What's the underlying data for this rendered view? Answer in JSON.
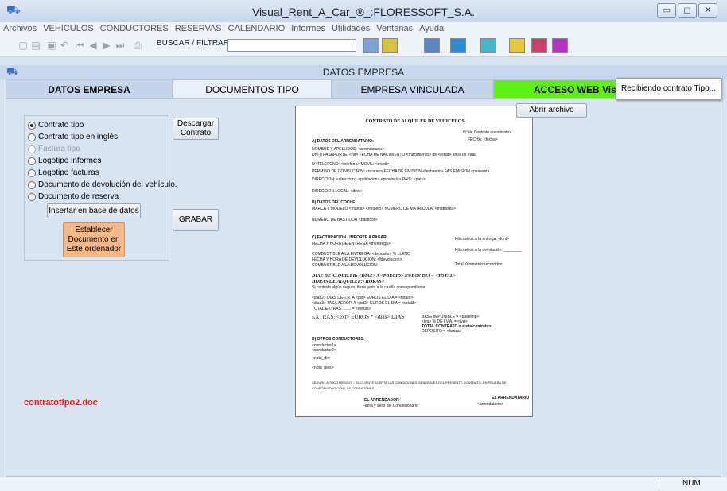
{
  "window": {
    "title": "Visual_Rent_A_Car_®_:FLORESSOFT_S.A."
  },
  "menu": [
    "Archivos",
    "VEHICULOS",
    "CONDUCTORES",
    "RESERVAS",
    "CALENDARIO",
    "Informes",
    "Utilidades",
    "Ventanas",
    "Ayuda"
  ],
  "toolbar": {
    "search_label": "BUSCAR / FILTRAR:",
    "search_value": ""
  },
  "mdi": {
    "title": "DATOS EMPRESA"
  },
  "tabs": [
    "DATOS EMPRESA",
    "DOCUMENTOS TIPO",
    "EMPRESA VINCULADA",
    "ACCESO WEB Vis"
  ],
  "options": {
    "items": [
      {
        "label": "Contrato tipo",
        "selected": true,
        "enabled": true
      },
      {
        "label": "Contrato tipo en inglés",
        "selected": false,
        "enabled": true
      },
      {
        "label": "Factura tipo",
        "selected": false,
        "enabled": false
      },
      {
        "label": "Logotipo informes",
        "selected": false,
        "enabled": true
      },
      {
        "label": "Logotipo facturas",
        "selected": false,
        "enabled": true
      },
      {
        "label": "Documento de devolución del vehículo.",
        "selected": false,
        "enabled": true
      },
      {
        "label": "Documento de reserva",
        "selected": false,
        "enabled": true
      }
    ],
    "insert_button": "Insertar en base de datos",
    "set_document_button": "Establecer Documento en Este ordenador"
  },
  "buttons": {
    "download": "Descargar Contrato",
    "save": "GRABAR",
    "open_file": "Abrir archivo"
  },
  "filename": "contratotipo2.doc",
  "tooltip": "Recibiendo contrato Tipo...",
  "status": {
    "num": "NUM"
  },
  "colors": {
    "accent_tab": "#5ef010",
    "filename": "#e02020",
    "set_doc_button": "#f4b98a"
  },
  "contract": {
    "title": "CONTRATO DE ALQUILER DE VEHICULOS",
    "contract_no": "Nº de Contrato  <ncontrato>",
    "fecha": "FECHA:  <fecha>",
    "section_a": "A) DATOS DEL ARRENDATARIO:",
    "a_lines": [
      "NOMBRE Y APELLIDOS:  <arrendatario>",
      "DNI o PASAPORTE:  <nif>    FECHA DE NACIMIENTO  <fnacimiento>  de <edad>  años de edad",
      "Nº TELEFONO:  <telefono>                    MOVIL:  <movil>",
      "PERMISO DE CONDUCIR Nº  <ncarne>    FECHA DE EMISION  <fechaemi>  FAS EMISION  <paisemi>",
      "DIRECCION:   <direccion>  <poblacion>  <provincia>        PAIS:  <pais>",
      "DIRECCION LOCAL:  <direl>"
    ],
    "section_b": "B) DATOS DEL COCHE:",
    "b_lines": [
      "MARCA Y MODELO        <marca>  <modelo>                 NUMERO DE MATRICULA:  <matricula>",
      "NUMERO DE BASTIDOR    <bastidor>"
    ],
    "section_c": "C) FACTURACION / IMPORTE A PAGAR",
    "c_lines": [
      "FECHA Y HORA DE ENTREGA  <fhentrega>",
      "COMBUSTIBLE A LA ENTREGA:       <deposito>  % LLENO",
      "FECHA Y HORA DE DEVOLUCION:      <fdevolucion>",
      "COMBUSTIBLE A LA DEVOLUCION:"
    ],
    "c_right": [
      "Kilometros a la entrega:    <kmt>",
      "Kilometros a la devolución: ________",
      "Total Kilometros recorridos:"
    ],
    "days_line": "DIAS DE ALQUILER:  <DIAS>  A    <PRECIO>  EUROS DIA    =    <TOTAL>",
    "hours_line": "HORAS DE ALQUILER:<HORAS>",
    "insurance": "Si contrata algún seguro, firme junto a la casilla correspondiente.",
    "tr_lines": [
      "<dias2> DIAS DE T.R.     A    <pst>   EUROS EL DIA          =    <totaltr>",
      "<dias3> TASA AEROP.    A    <pst2>  EUROS EL DIA          =    <total3>",
      "                                           TOTAL EXTRAS.........     =    <extras>"
    ],
    "extras": "EXTRAS:  <ext>  EUROS * <dias> DIAS",
    "totals": [
      "BASE IMPONIBLE          =    <baseimp>",
      "<iva> % DE I.V.A.        =    <iva>",
      "TOTAL CONTRATO       =    <totalcontrato>",
      "DEPOSITO                    =    <fianza>"
    ],
    "section_d": "D) OTROS CONDUCTORES:",
    "d_lines": [
      "<conductor1>",
      "<conductor2>",
      "<nota_dir>",
      "<nota_pies>"
    ],
    "legal": "SEGURO A TODO RIESGO ...   EL CLIENTE ACEPTA LAS CONDICIONES GENERALES DEL PRESENTE CONTRATO, EN PRUEBA DE CONFORMIDAD CON LAS CONDICIONES ...",
    "sign_left": "EL ARRENDADOR",
    "sign_right": "EL ARRENDATARIO",
    "sign_left_sub": "Firma y sello del Concesionario",
    "sign_right_sub": "<arrendatario>"
  }
}
